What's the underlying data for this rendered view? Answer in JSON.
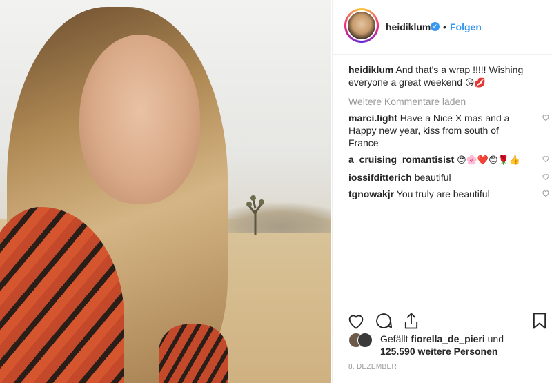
{
  "post": {
    "username": "heidiklum",
    "follow_label": "Folgen",
    "dot": "•",
    "caption_user": "heidiklum",
    "caption_text": "And that's a wrap !!!!! Wishing everyone a great weekend",
    "caption_emoji": "😘💋",
    "load_more": "Weitere Kommentare laden",
    "comments": [
      {
        "user": "marci.light",
        "text": "Have a Nice X mas and a Happy new year, kiss from south of France",
        "emoji": ""
      },
      {
        "user": "a_cruising_romantisist",
        "text": "",
        "emoji": "😍🌸❤️😊🌹👍"
      },
      {
        "user": "iossifditterich",
        "text": "beautiful",
        "emoji": ""
      },
      {
        "user": "tgnowakjr",
        "text": "You truly are beautiful",
        "emoji": ""
      }
    ],
    "likes_prefix": "Gefällt",
    "likes_user": "fiorella_de_pieri",
    "likes_and": "und",
    "likes_count": "125.590",
    "likes_suffix": "weitere Personen",
    "date": "8. DEZEMBER"
  },
  "icons": {
    "verified": "verified-badge-icon",
    "like": "heart-icon",
    "comment": "comment-icon",
    "share": "share-icon",
    "save": "bookmark-icon"
  },
  "colors": {
    "link": "#3897f0",
    "muted": "#999999",
    "text": "#262626"
  }
}
